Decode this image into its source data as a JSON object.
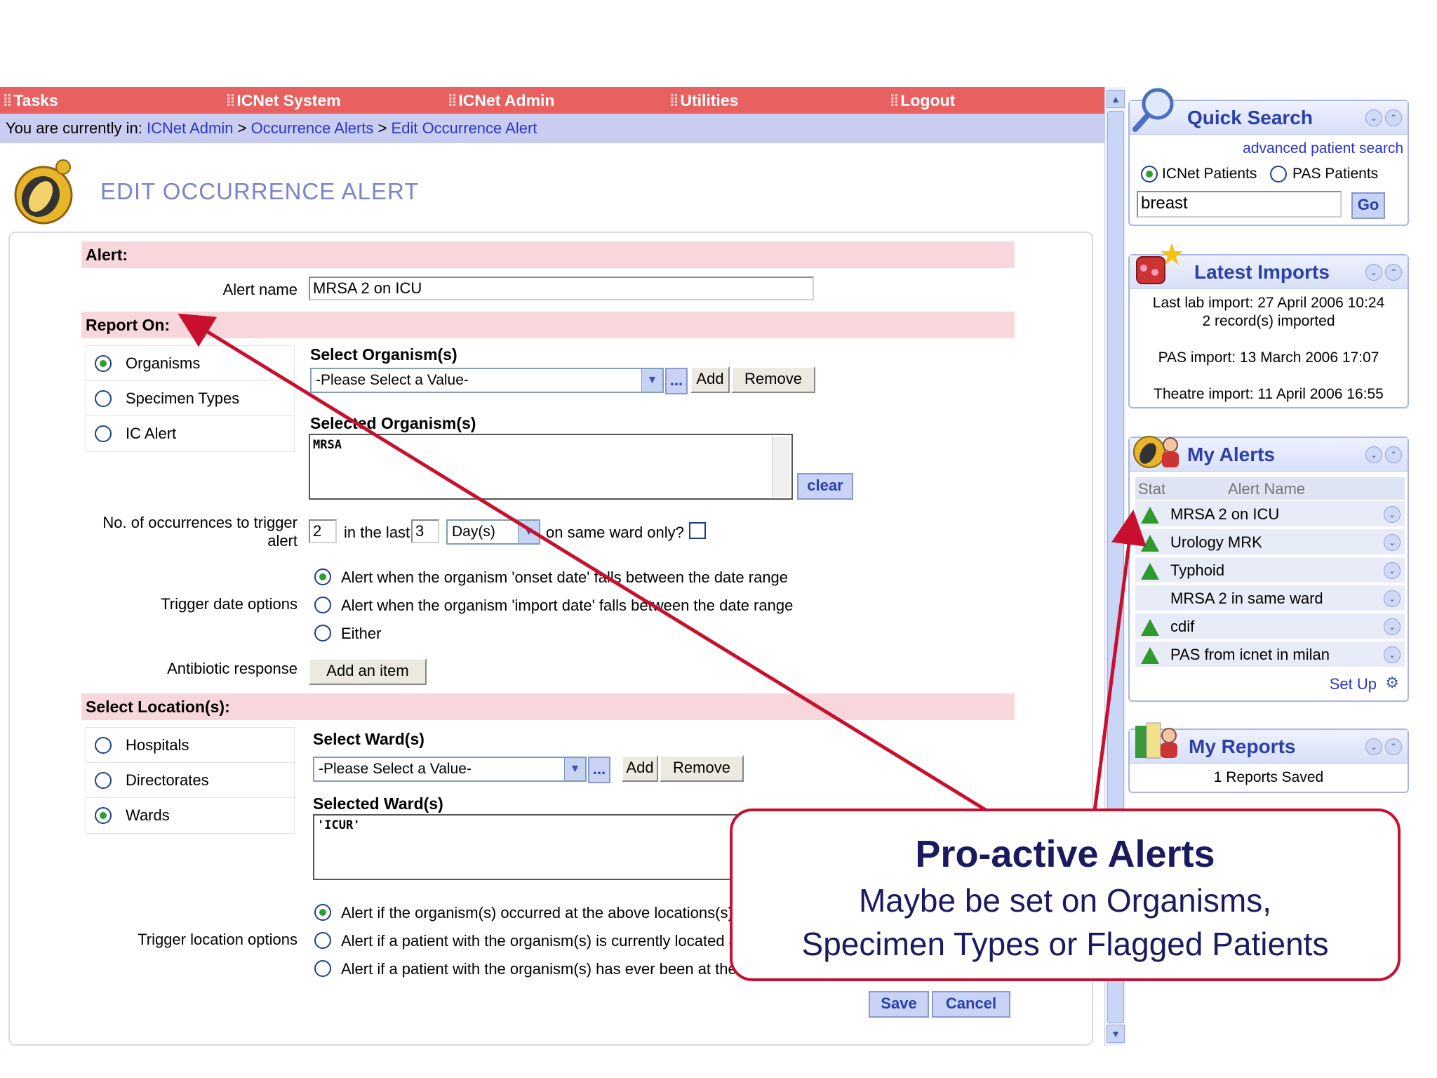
{
  "nav": {
    "items": [
      "Tasks",
      "ICNet System",
      "ICNet Admin",
      "Utilities",
      "Logout"
    ]
  },
  "breadcrumb": {
    "prefix": "You are currently in:",
    "items": [
      "ICNet Admin",
      "Occurrence Alerts",
      "Edit Occurrence Alert"
    ],
    "separator": ">"
  },
  "page": {
    "title": "EDIT OCCURRENCE ALERT"
  },
  "sections": {
    "alert": "Alert:",
    "report_on": "Report On:",
    "select_locations": "Select Location(s):"
  },
  "alert_name": {
    "label": "Alert name",
    "value": "MRSA 2 on ICU"
  },
  "report_on": {
    "options": [
      {
        "label": "Organisms",
        "selected": true
      },
      {
        "label": "Specimen Types",
        "selected": false
      },
      {
        "label": "IC Alert",
        "selected": false
      }
    ],
    "select_label": "Select Organism(s)",
    "select_value": "-Please Select a Value-",
    "ellipsis": "...",
    "add": "Add",
    "remove": "Remove",
    "selected_label": "Selected Organism(s)",
    "selected_items": [
      "MRSA"
    ],
    "clear": "clear"
  },
  "occurrences": {
    "label_line1": "No. of occurrences to trigger",
    "label_line2": "alert",
    "count": "2",
    "in_the_last": "in the last",
    "period": "3",
    "unit": "Day(s)",
    "same_ward": "on same ward only?"
  },
  "trigger_date": {
    "label": "Trigger date options",
    "options": [
      {
        "label": "Alert when the organism 'onset date' falls between the date range",
        "selected": true
      },
      {
        "label": "Alert when the organism 'import date' falls between the date range",
        "selected": false
      },
      {
        "label": "Either",
        "selected": false
      }
    ]
  },
  "antibiotic": {
    "label": "Antibiotic response",
    "button": "Add an item"
  },
  "locations": {
    "options": [
      {
        "label": "Hospitals",
        "selected": false
      },
      {
        "label": "Directorates",
        "selected": false
      },
      {
        "label": "Wards",
        "selected": true
      }
    ],
    "select_label": "Select Ward(s)",
    "select_value": "-Please Select a Value-",
    "ellipsis": "...",
    "add": "Add",
    "remove": "Remove",
    "selected_label": "Selected Ward(s)",
    "selected_items": [
      "'ICUR'"
    ]
  },
  "trigger_location": {
    "label": "Trigger location options",
    "options": [
      {
        "label": "Alert if the organism(s) occurred at the above locations(s).",
        "selected": true
      },
      {
        "label": "Alert if a patient with the organism(s) is currently located at t",
        "selected": false
      },
      {
        "label": "Alert if a patient with the organism(s) has ever been at the ab",
        "selected": false
      }
    ]
  },
  "actions": {
    "save": "Save",
    "cancel": "Cancel"
  },
  "quick_search": {
    "title": "Quick Search",
    "advanced": "advanced patient search",
    "opt1": "ICNet Patients",
    "opt2": "PAS Patients",
    "query": "breast",
    "go": "Go"
  },
  "latest_imports": {
    "title": "Latest Imports",
    "lab_line1": "Last lab import: 27 April 2006 10:24",
    "lab_line2": "2 record(s) imported",
    "pas": "PAS import: 13 March 2006 17:07",
    "theatre": "Theatre import: 11 April 2006 16:55"
  },
  "my_alerts": {
    "title": "My Alerts",
    "col_status": "Stat",
    "col_name": "Alert Name",
    "rows": [
      {
        "name": "MRSA 2 on ICU",
        "triggered": true
      },
      {
        "name": "Urology MRK",
        "triggered": true
      },
      {
        "name": "Typhoid",
        "triggered": true
      },
      {
        "name": "MRSA 2 in same ward",
        "triggered": false
      },
      {
        "name": "cdif",
        "triggered": true
      },
      {
        "name": "PAS from icnet in milan",
        "triggered": true
      }
    ],
    "setup": "Set Up"
  },
  "my_reports": {
    "title": "My Reports",
    "summary": "1 Reports Saved"
  },
  "callout": {
    "title": "Pro-active Alerts",
    "line1": "Maybe be set on Organisms,",
    "line2": "Specimen Types or Flagged Patients"
  },
  "colors": {
    "nav": "#e86060",
    "section": "#f7d7db",
    "accent": "#c8102e",
    "link": "#2a35c8",
    "triggered": "#2e9a2e"
  }
}
